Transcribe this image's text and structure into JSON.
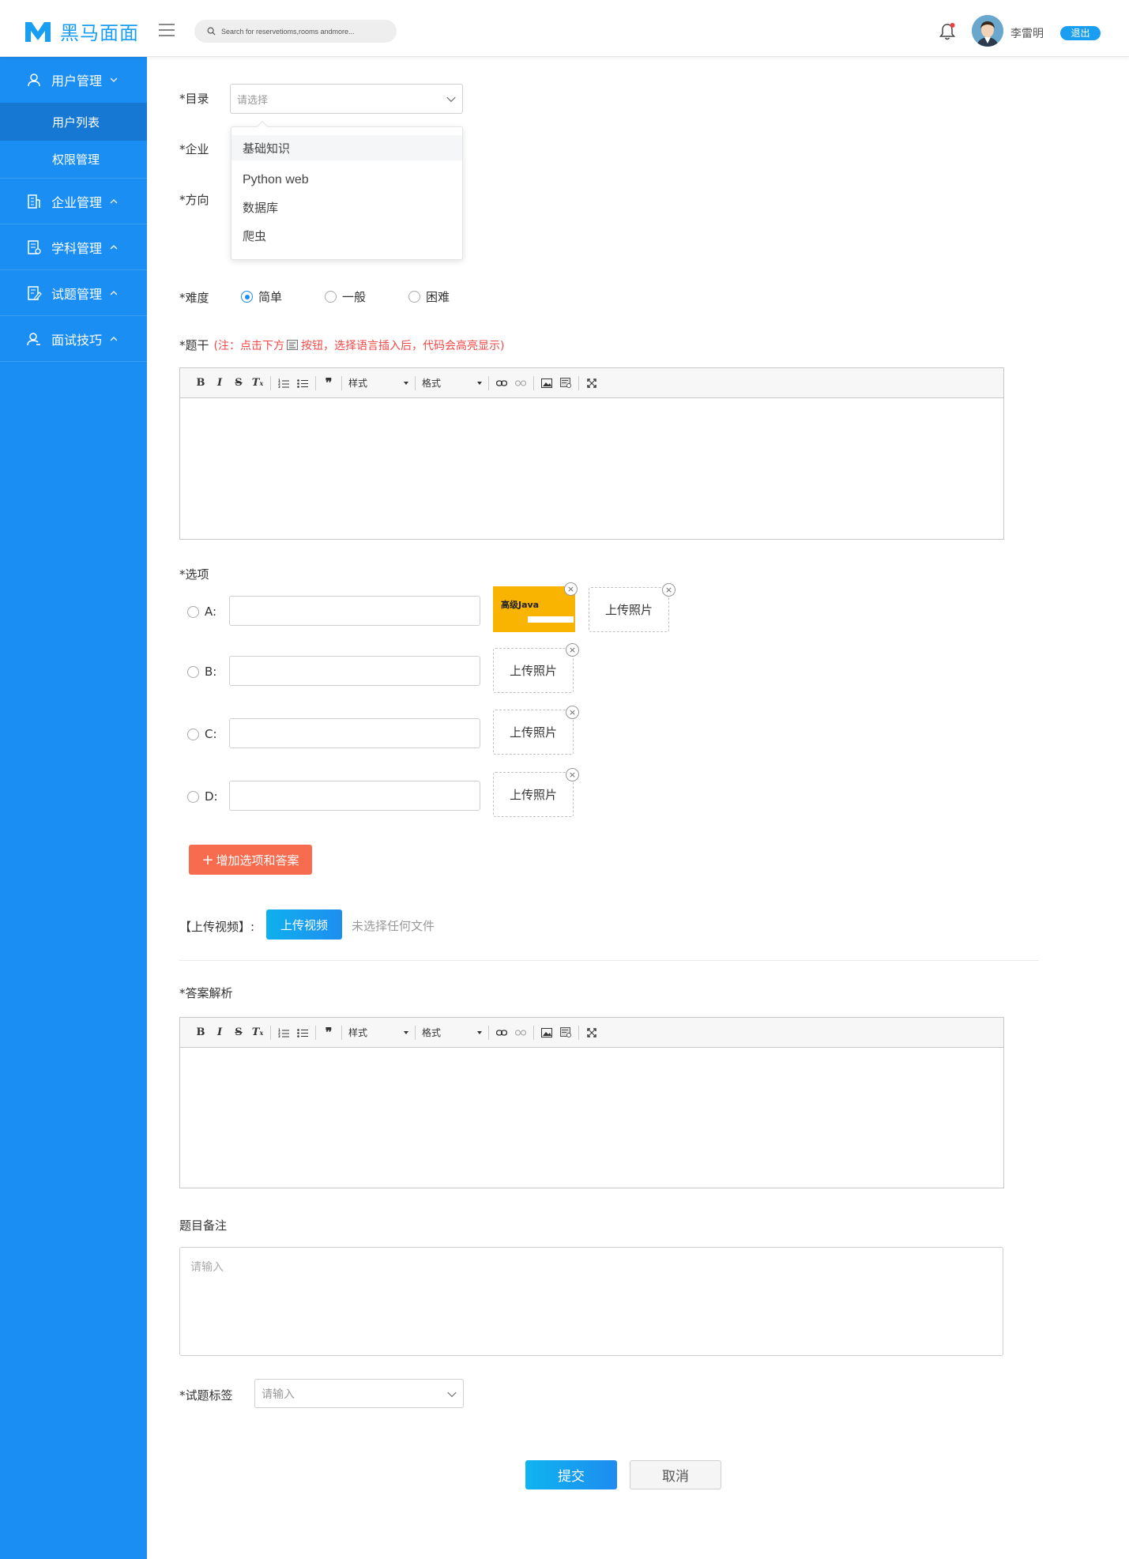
{
  "header": {
    "brand": "黑马面面",
    "search_placeholder": "Search for reservetioms,rooms andmore...",
    "username": "李雷明",
    "logout_label": "退出",
    "brand_color": "#1a9ef2"
  },
  "sidebar": {
    "items": [
      {
        "label": "用户管理",
        "icon": "user-icon",
        "expanded": true
      },
      {
        "label": "用户列表",
        "sub": true,
        "active": true
      },
      {
        "label": "权限管理",
        "sub": true
      },
      {
        "label": "企业管理",
        "icon": "building-icon"
      },
      {
        "label": "学科管理",
        "icon": "subject-icon"
      },
      {
        "label": "试题管理",
        "icon": "edit-doc-icon"
      },
      {
        "label": "面试技巧",
        "icon": "person-icon"
      }
    ]
  },
  "form": {
    "catalog_label": "*目录",
    "catalog_placeholder": "请选择",
    "company_label": "*企业",
    "direction_label": "*方向",
    "dropdown_options": [
      "基础知识",
      "Python web",
      "数据库",
      "爬虫"
    ],
    "difficulty_label": "*难度",
    "difficulty_options": [
      "简单",
      "一般",
      "困难"
    ],
    "difficulty_selected": "简单",
    "stem_label": "*题干",
    "stem_hint_prefix": "(注：点击下方",
    "stem_hint_suffix": "按钮，选择语言插入后，代码会高亮显示)",
    "toolbar": {
      "style_label": "样式",
      "format_label": "格式"
    },
    "options_label": "*选项",
    "options": [
      {
        "letter": "A:"
      },
      {
        "letter": "B:"
      },
      {
        "letter": "C:"
      },
      {
        "letter": "D:"
      }
    ],
    "upload_photo_label": "上传照片",
    "thumb_title": "高级Java",
    "add_option_label": "增加选项和答案",
    "video_label": "【上传视频】:",
    "video_button": "上传视频",
    "video_status": "未选择任何文件",
    "analysis_label": "*答案解析",
    "remark_label": "题目备注",
    "remark_placeholder": "请输入",
    "tags_label": "*试题标签",
    "tags_placeholder": "请输入",
    "submit_label": "提交",
    "cancel_label": "取消"
  }
}
